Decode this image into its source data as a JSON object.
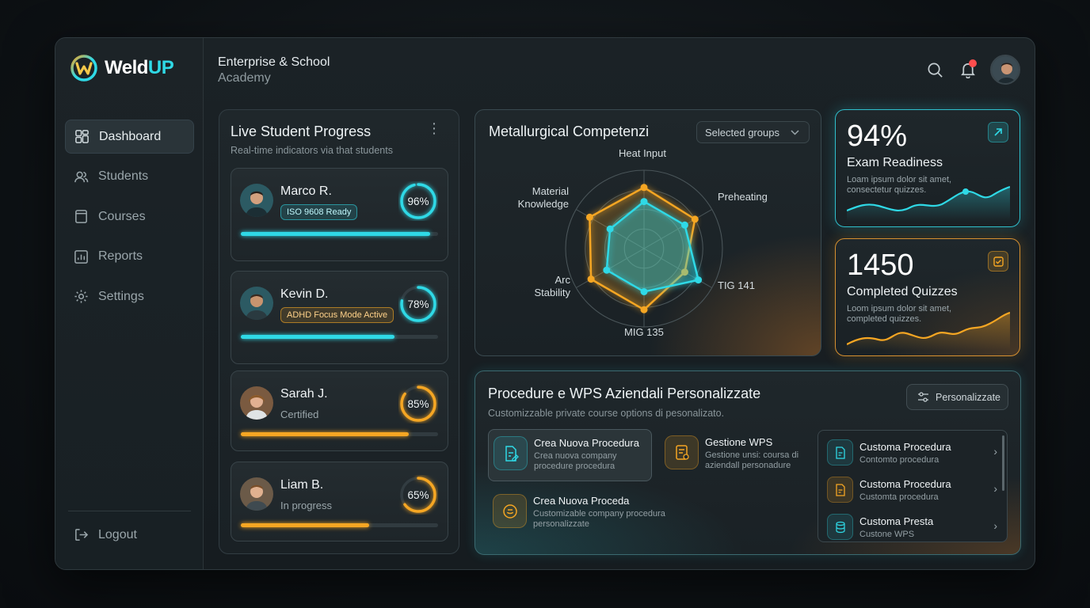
{
  "brand": {
    "name_a": "Weld",
    "name_b": "UP"
  },
  "header": {
    "line1": "Enterprise & School",
    "line2": "Academy"
  },
  "sidebar": {
    "items": [
      {
        "label": "Dashboard"
      },
      {
        "label": "Students"
      },
      {
        "label": "Courses"
      },
      {
        "label": "Reports"
      },
      {
        "label": "Settings"
      }
    ],
    "logout": "Logout"
  },
  "live": {
    "title": "Live Student Progress",
    "subtitle": "Real-time indicators via that students",
    "students": [
      {
        "name": "Marco R.",
        "badge": "ISO 9608 Ready",
        "badge_style": "cyan",
        "status": "",
        "percent_label": "96%",
        "progress": 0.96,
        "color": "#2fd9e6"
      },
      {
        "name": "Kevin D.",
        "badge": "ADHD Focus Mode Active",
        "badge_style": "orange",
        "status": "",
        "percent_label": "78%",
        "progress": 0.78,
        "color": "#2fd9e6"
      },
      {
        "name": "Sarah J.",
        "badge": "",
        "status": "Certified",
        "percent_label": "85%",
        "progress": 0.85,
        "color": "#f5a623"
      },
      {
        "name": "Liam B.",
        "badge": "",
        "status": "In progress",
        "percent_label": "65%",
        "progress": 0.65,
        "color": "#f5a623"
      }
    ]
  },
  "radar": {
    "title": "Metallurgical Competenzi",
    "select_value": "Selected groups",
    "axes": [
      "Heat Input",
      "Preheating",
      "TIG 141",
      "MIG 135",
      "Arc Stability",
      "Material Knowledge"
    ],
    "series": [
      {
        "color": "#f5a623",
        "values": [
          0.78,
          0.75,
          0.6,
          0.78,
          0.78,
          0.8
        ]
      },
      {
        "color": "#2fd9e6",
        "values": [
          0.6,
          0.6,
          0.8,
          0.55,
          0.55,
          0.5
        ]
      }
    ]
  },
  "stats": [
    {
      "value": "94%",
      "label": "Exam Readiness",
      "desc": "Loam ipsum dolor sit amet, consectetur quizzes.",
      "color": "#2fd9e6",
      "icon": "arrow-up-right-icon"
    },
    {
      "value": "1450",
      "label": "Completed Quizzes",
      "desc": "Loom ipsum dolor sit amet, completed quizzes.",
      "color": "#f5a623",
      "icon": "check-square-icon"
    }
  ],
  "wps": {
    "title": "Procedure e WPS Aziendali Personalizzate",
    "subtitle": "Customizzable private course options di pesonalizato.",
    "filter_label": "Personalizzate",
    "actions": [
      {
        "title": "Crea Nuova Procedura",
        "desc": "Crea nuova company procedure procedura"
      },
      {
        "title": "Gestione WPS",
        "desc": "Gestione unsi: coursa di aziendall personadure"
      },
      {
        "title": "Crea Nuova Proceda",
        "desc": "Customizable company procedura personalizzate"
      }
    ],
    "list": [
      {
        "title": "Customa Procedura",
        "desc": "Contomto procedura"
      },
      {
        "title": "Customa Procedura",
        "desc": "Customta procedura"
      },
      {
        "title": "Customa Presta",
        "desc": "Custone WPS"
      }
    ]
  },
  "colors": {
    "accent": "#2fd9e6",
    "warm": "#f5a623",
    "alert": "#ff4d4d"
  }
}
